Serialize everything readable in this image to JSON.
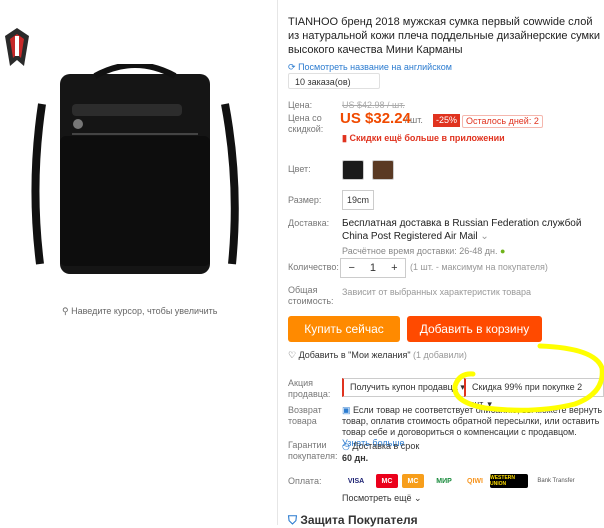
{
  "logo_text": "TIANHOO",
  "zoom_hint": "Наведите курсор, чтобы увеличить",
  "title": "TIANHOO бренд 2018 мужская сумка первый cowwide слой из натуральной кожи плеча поддельные дизайнерские сумки высокого качества Мини Карманы",
  "english_link": "Посмотреть название на английском",
  "orders": "10 заказа(ов)",
  "price_label": "Цена:",
  "old_price": "US $42.98 / шт.",
  "discount_label": "Цена со скидкой:",
  "price": "US $32.24",
  "per_unit": "/ шт.",
  "discount": "-25%",
  "days_left": "Осталось дней: 2",
  "app_discount": "Скидки ещё больше в приложении",
  "color_label": "Цвет:",
  "size_label": "Размер:",
  "size_value": "19cm",
  "delivery_label": "Доставка:",
  "shipping_text": "Бесплатная доставка в Russian Federation службой China Post Registered Air Mail",
  "delivery_time": "Расчётное время доставки: 26-48 дн.",
  "quantity_label": "Количество:",
  "quantity_minus": "−",
  "quantity_value": "1",
  "quantity_plus": "+",
  "quantity_note": "(1 шт. - максимум на покупателя)",
  "total_label": "Общая стоимость:",
  "total_note": "Зависит от выбранных характеристик товара",
  "buy_now": "Купить сейчас",
  "add_to_cart": "Добавить в корзину",
  "wishlist": "Добавить в \"Мои желания\"",
  "wishlist_count": "(1 добавили)",
  "promo_label": "Акция продавца:",
  "coupon_button": "Получить купон продавца",
  "promo_select": "Скидка 99% при покупке 2 шт.",
  "return_label": "Возврат товара",
  "return_text": "Если товар не соответствует описанию, вы можете вернуть товар, оплатив стоимость обратной пересылки, или оставить товар себе и договориться о компенсации с продавцом.",
  "return_link": "Узнать больше",
  "guarantee_label": "Гарантии покупателя:",
  "guarantee_text": "Доставка в срок",
  "guarantee_days": "60 дн.",
  "payment_label": "Оплата:",
  "payment_methods": [
    "VISA",
    "MC",
    "MC",
    "МИР",
    "QIWI",
    "WESTERN UNION",
    "Bank Transfer"
  ],
  "payment_more": "Посмотреть ещё",
  "bottom_heading": "Защита Покупателя",
  "colors": {
    "price": "#f04a00",
    "buy": "#ff8a00",
    "cart": "#ff4a00",
    "highlight": "#ffff00",
    "link": "#2c7cd0"
  }
}
